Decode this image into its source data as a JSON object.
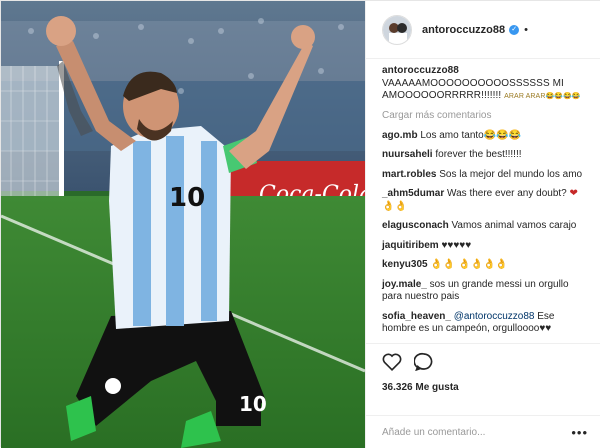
{
  "post": {
    "username": "antoroccuzzo88",
    "more_dots": "•",
    "verified_mark": "✓"
  },
  "caption": {
    "user": "antoroccuzzo88",
    "text": "VAAAAAMOOOOOOOOOOSSSSSS MI AMOOOOOORRRRR!!!!!!!",
    "emoji_tail": "ARAR ARAR😂😂😂😂"
  },
  "load_more": "Cargar más comentarios",
  "comments": [
    {
      "user": "ago.mb",
      "text": "Los amo tanto😂😂😂"
    },
    {
      "user": "nuursaheli",
      "text": "forever the best!!!!!!"
    },
    {
      "user": "mart.robles",
      "text": "Sos la mejor del mundo los amo"
    },
    {
      "user": "_ahm5dumar",
      "text": "Was there ever any doubt?",
      "tail": "❤ 👌👌"
    },
    {
      "user": "elagusconach",
      "text": "Vamos animal vamos carajo"
    },
    {
      "user": "jaquitiribem",
      "text": "♥♥♥♥♥"
    },
    {
      "user": "kenyu305",
      "text": "👌👌 👌👌👌👌"
    },
    {
      "user": "joy.male_",
      "text": "sos un grande messi un orgullo para nuestro pais"
    },
    {
      "user": "sofia_heaven_",
      "mention": "@antoroccuzzo88",
      "text": "Ese hombre es un campeón, orgulloooo♥♥"
    }
  ],
  "likes": "36.326 Me gusta",
  "add_comment": {
    "placeholder": "Añade un comentario..."
  },
  "icons": {
    "like": "heart-icon",
    "comment": "comment-bubble-icon",
    "options": "more-options-icon"
  },
  "colors": {
    "accent": "#3897f0",
    "text": "#262626",
    "muted": "#999999",
    "border": "#efefef"
  }
}
